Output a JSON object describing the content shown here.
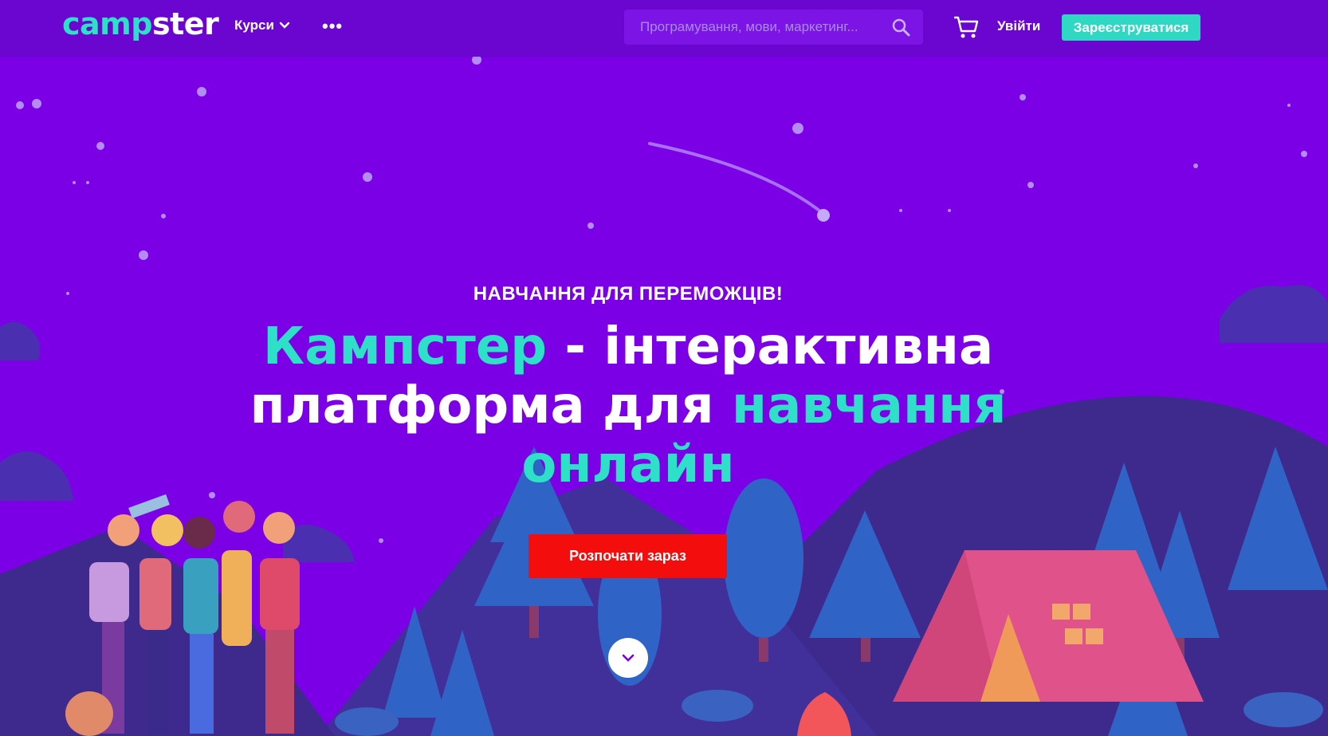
{
  "header": {
    "logo_part1": "camp",
    "logo_part2": "ster",
    "nav_courses_label": "Курси",
    "nav_more_label": "•••",
    "search_placeholder": "Програмування, мови, маркетинг...",
    "login_label": "Увійти",
    "register_label": "Зареєструватися"
  },
  "hero": {
    "eyebrow": "НАВЧАННЯ ДЛЯ ПЕРЕМОЖЦІВ!",
    "title_part1": "Кампстер",
    "title_part2": " - інтерактивна платформа для ",
    "title_part3": "навчання онлайн",
    "cta_label": "Розпочати зараз"
  },
  "colors": {
    "background": "#7b00e6",
    "header": "#6a06cf",
    "accent": "#2fe0c8",
    "cta": "#f40d0d"
  },
  "icons": [
    "chevron-down-icon",
    "search-icon",
    "cart-icon",
    "scroll-down-icon"
  ]
}
